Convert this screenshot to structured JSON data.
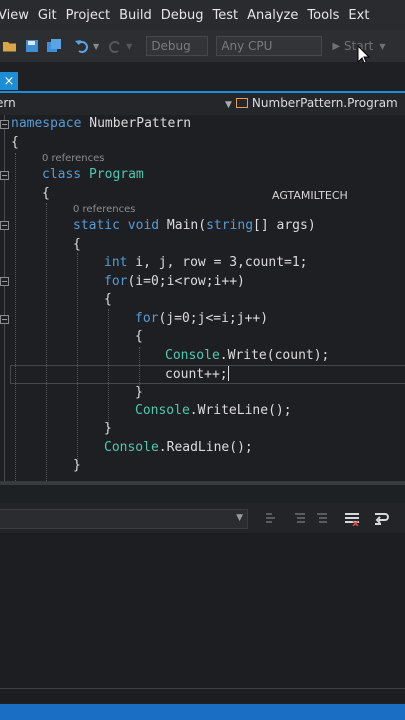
{
  "menu": [
    "View",
    "Git",
    "Project",
    "Build",
    "Debug",
    "Test",
    "Analyze",
    "Tools",
    "Ext"
  ],
  "toolbar": {
    "config_placeholder": "Debug",
    "platform_placeholder": "Any CPU",
    "start_label": "Start"
  },
  "tab": {
    "close_glyph": "×"
  },
  "nav": {
    "project_fragment": "ern",
    "class_path": "NumberPattern.Program"
  },
  "editor": {
    "lines": {
      "namespace_kw": "namespace",
      "namespace_name": " NumberPattern",
      "brace_open_1": "{",
      "refs_1": "0 references",
      "class_kw": "class",
      "class_name": "Program",
      "brace_open_2": "{",
      "refs_2": "0 references",
      "main_kw": "static void",
      "main_rest": " Main(",
      "main_type": "string",
      "main_args": "[] args)",
      "brace_open_3": "{",
      "int_kw": "int",
      "int_rest": " i, j, row = 3,count=1;",
      "for1_kw": "for",
      "for1_rest": "(i=0;i<row;i++)",
      "brace_open_4": "{",
      "for2_kw": "for",
      "for2_rest": "(j=0;j<=i;j++)",
      "brace_open_5": "{",
      "console1_type": "Console",
      "console1_rest": ".Write(count);",
      "count_inc": "count++;",
      "brace_close_5": "}",
      "console2_type": "Console",
      "console2_rest": ".WriteLine();",
      "brace_close_4": "}",
      "console3_type": "Console",
      "console3_rest": ".ReadLine();",
      "brace_close_3": "}"
    },
    "watermark": "AGTAMILTECH"
  },
  "colors": {
    "keyword": "#569cd6",
    "type": "#4ec9b0",
    "accent": "#1c8ed6"
  }
}
